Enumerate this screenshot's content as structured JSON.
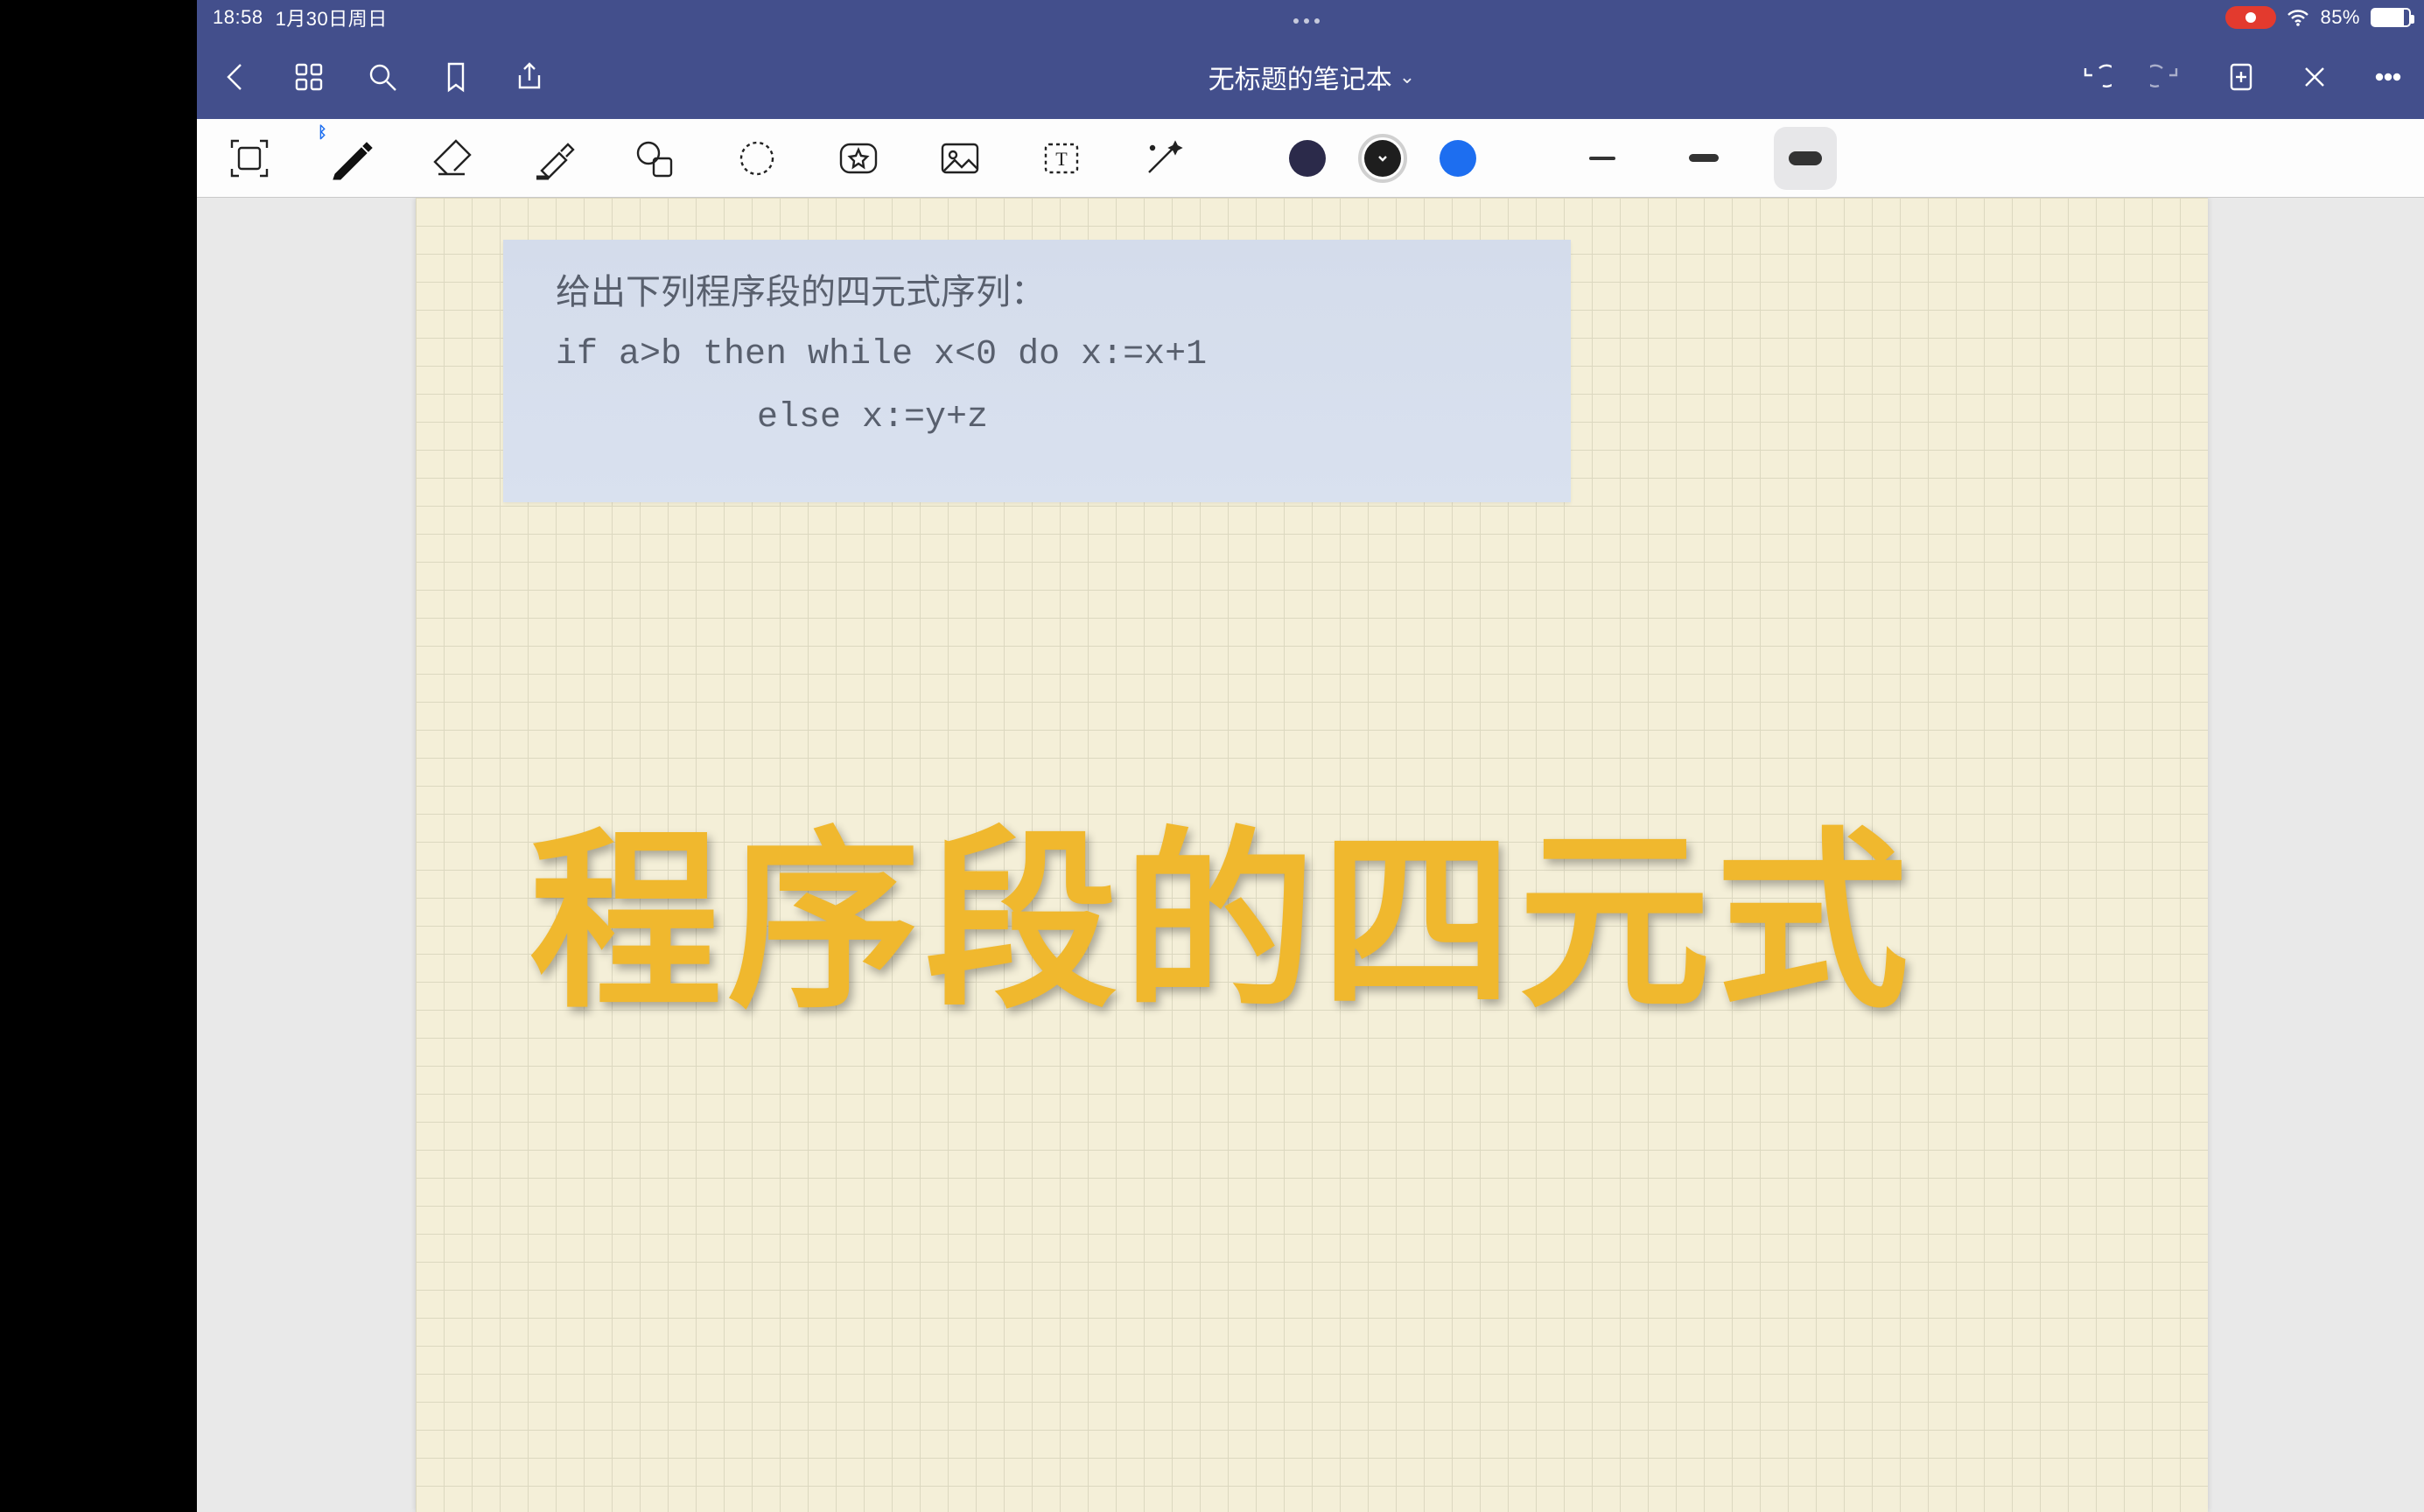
{
  "statusbar": {
    "time": "18:58",
    "date": "1月30日周日",
    "battery_pct": "85%"
  },
  "titlebar": {
    "title": "无标题的笔记本"
  },
  "toolbar": {
    "tools": {
      "scan": {
        "name": "scan-icon"
      },
      "pen": {
        "name": "pen-icon",
        "selected": true,
        "bluetooth": true
      },
      "eraser": {
        "name": "eraser-icon"
      },
      "highlight": {
        "name": "highlighter-icon"
      },
      "shapes": {
        "name": "shapes-icon"
      },
      "lasso": {
        "name": "lasso-icon"
      },
      "star": {
        "name": "star-stamp-icon"
      },
      "image": {
        "name": "image-icon"
      },
      "text": {
        "name": "text-box-icon"
      },
      "wand": {
        "name": "wand-icon"
      }
    },
    "colors": [
      {
        "hex": "#2b2a4a",
        "selected": false
      },
      {
        "hex": "#1e1e1e",
        "selected": true
      },
      {
        "hex": "#1d6ef0",
        "selected": false
      }
    ],
    "strokes": [
      {
        "h": 4,
        "selected": false
      },
      {
        "h": 8,
        "selected": false
      },
      {
        "h": 14,
        "selected": true
      }
    ]
  },
  "document": {
    "snippet": {
      "line1": "给出下列程序段的四元式序列：",
      "line2": "if a>b then while x<0 do x:=x+1",
      "line3": "else x:=y+z"
    },
    "big_title": "程序段的四元式"
  }
}
